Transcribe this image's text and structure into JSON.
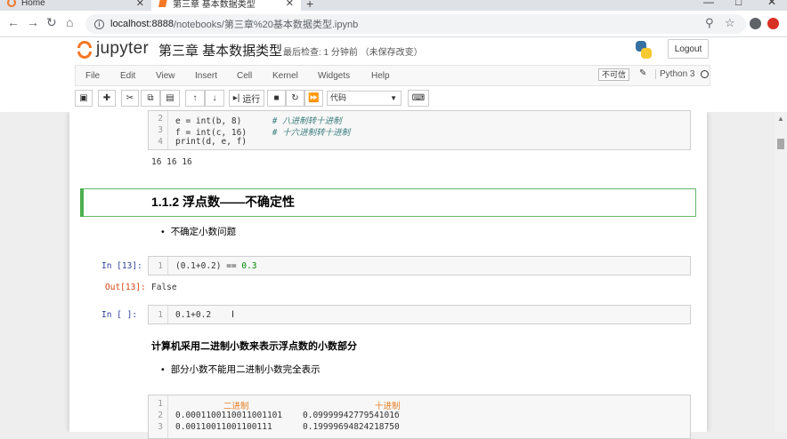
{
  "browser": {
    "tabs": [
      {
        "label": "Home"
      },
      {
        "label": "第三章 基本数据类型"
      }
    ],
    "new_tab": "+",
    "url_host": "localhost:8888",
    "url_path": "/notebooks/第三章%20基本数据类型.ipynb",
    "window_controls": [
      "—",
      "□",
      "✕"
    ]
  },
  "header": {
    "app_name": "jupyter",
    "notebook_title": "第三章 基本数据类型",
    "checkpoint": "最后检查: 1 分钟前 （未保存改变）",
    "logout_label": "Logout"
  },
  "menu": {
    "items": [
      "File",
      "Edit",
      "View",
      "Insert",
      "Cell",
      "Kernel",
      "Widgets",
      "Help"
    ],
    "trusted_label": "不可信",
    "kernel_name": "Python 3"
  },
  "toolbar": {
    "run_label": "运行",
    "cell_type": "代码"
  },
  "cells": {
    "top_code": {
      "line_numbers": [
        "2",
        "3",
        "4"
      ],
      "line2_code": "e = int(b, 8)",
      "line2_comment": "# 八进制转十进制",
      "line3_code": "f = int(c, 16)",
      "line3_comment": "# 十六进制转十进制",
      "line4_code": "print(d, e, f)"
    },
    "top_output": "16 16 16",
    "heading": "1.1.2 浮点数——不确定性",
    "bullet1": "不确定小数问题",
    "cell13": {
      "prompt": "In [13]:",
      "line_no": "1",
      "code_a": "(0.1+0.2) == ",
      "code_b": "0.3",
      "out_prompt": "Out[13]:",
      "output": "False"
    },
    "active_cell": {
      "prompt": "In [ ]:",
      "line_no": "1",
      "code": "0.1+0.2"
    },
    "bold_text": "计算机采用二进制小数来表示浮点数的小数部分",
    "bullet2": "部分小数不能用二进制小数完全表示",
    "table_code": {
      "line_numbers": [
        "1",
        "2",
        "3"
      ],
      "header_bin": "二进制",
      "header_dec": "十进制",
      "row1_bin": "0.0001100110011001101",
      "row1_dec": "0.0999994277954101б",
      "row2_bin": "0.00110011001100111",
      "row2_dec": "0.19999694824218750"
    }
  }
}
